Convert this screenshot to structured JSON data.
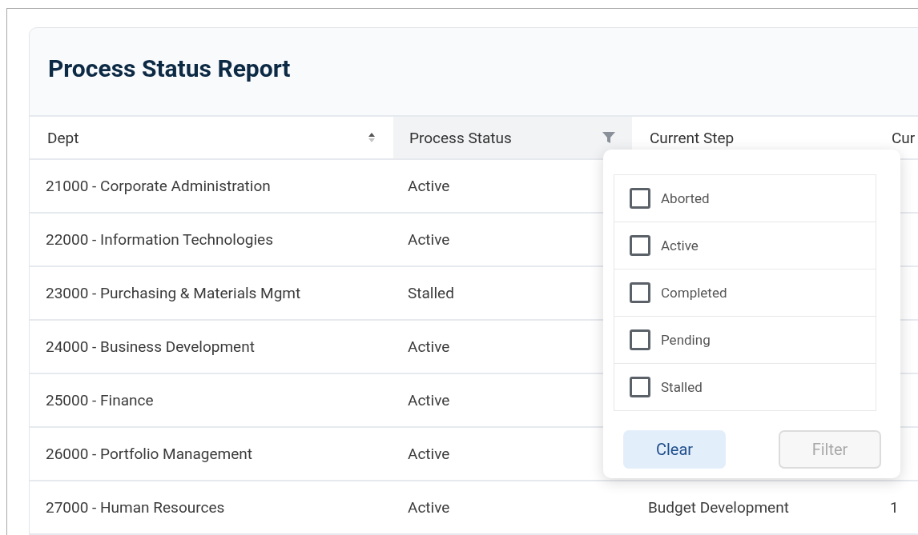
{
  "report": {
    "title": "Process Status Report"
  },
  "table": {
    "columns": [
      {
        "label": "Dept",
        "kind": "sort"
      },
      {
        "label": "Process Status",
        "kind": "filter"
      },
      {
        "label": "Current Step",
        "kind": "plain"
      },
      {
        "label": "Cur",
        "kind": "plain"
      }
    ],
    "rows": [
      {
        "dept": "21000 - Corporate Administration",
        "status": "Active"
      },
      {
        "dept": "22000 - Information Technologies",
        "status": "Active"
      },
      {
        "dept": "23000 - Purchasing & Materials Mgmt",
        "status": "Stalled"
      },
      {
        "dept": "24000 - Business Development",
        "status": "Active"
      },
      {
        "dept": "25000 - Finance",
        "status": "Active"
      },
      {
        "dept": "26000 - Portfolio Management",
        "status": "Active"
      },
      {
        "dept": "27000 - Human Resources",
        "status": "Active",
        "step": "Budget Development",
        "column_4": "1"
      }
    ]
  },
  "filter_popup": {
    "options": [
      {
        "label": "Aborted",
        "checked": false
      },
      {
        "label": "Active",
        "checked": false
      },
      {
        "label": "Completed",
        "checked": false
      },
      {
        "label": "Pending",
        "checked": false
      },
      {
        "label": "Stalled",
        "checked": false
      }
    ],
    "buttons": [
      {
        "label": "Clear",
        "kind": "secondary",
        "disabled": false
      },
      {
        "label": "Filter",
        "kind": "primary",
        "disabled": true
      }
    ]
  }
}
